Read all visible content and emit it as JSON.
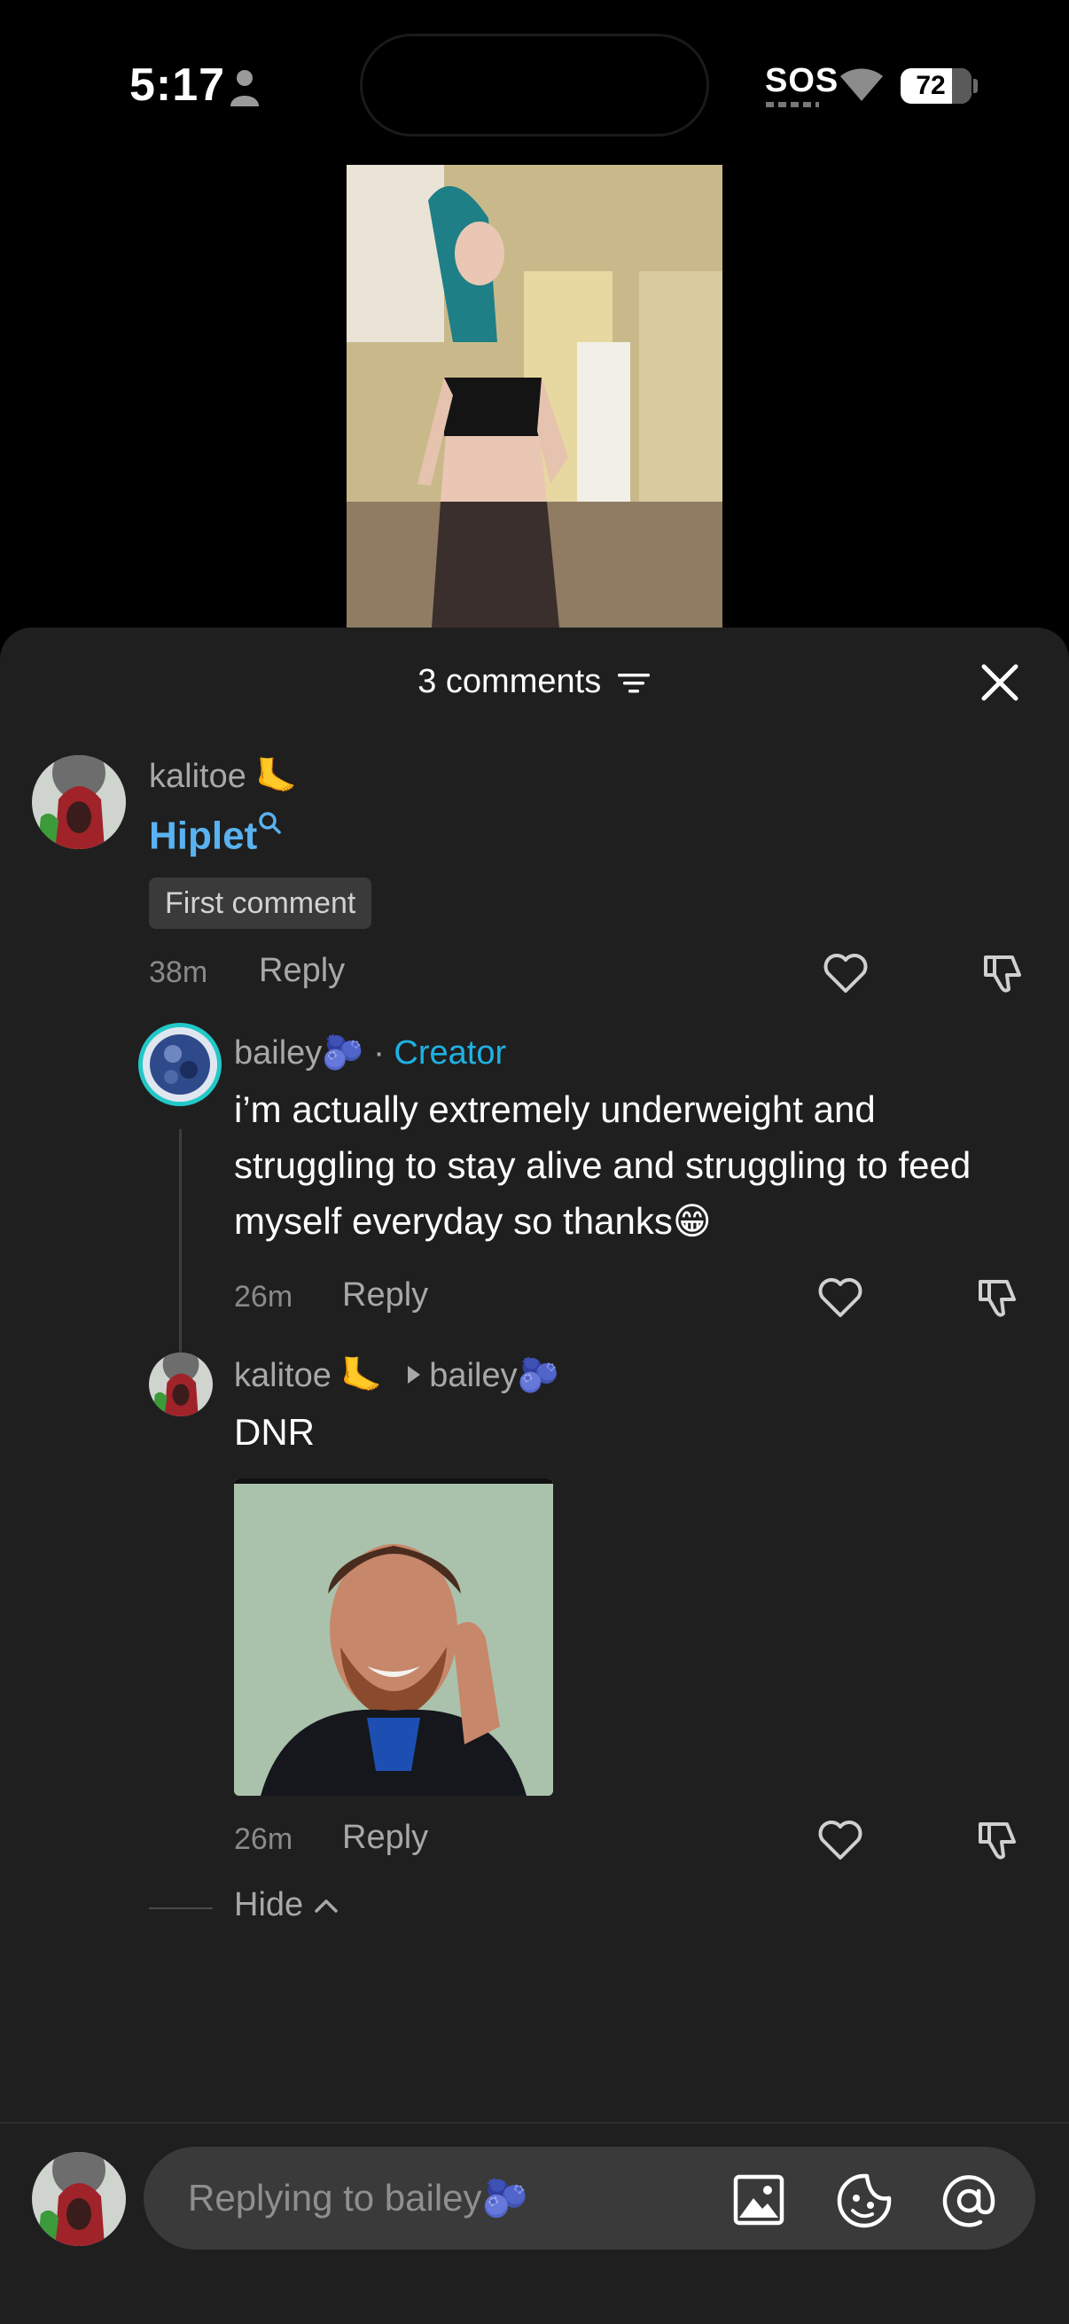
{
  "status_bar": {
    "time": "5:17",
    "carrier": "SOS",
    "battery": "72",
    "battery_fraction": 0.72,
    "icons": [
      "person-icon",
      "wifi-icon",
      "battery-icon"
    ]
  },
  "video": {
    "description_icon": "video-thumbnail"
  },
  "header": {
    "count_label": "3 comments",
    "icons": [
      "filter-icon",
      "close-icon"
    ]
  },
  "comments": [
    {
      "username": "kalitoe",
      "emoji": "🦶",
      "search_term": "Hiplet",
      "badge": "First comment",
      "time": "38m",
      "reply_label": "Reply"
    },
    {
      "username": "bailey",
      "emoji": "🫐",
      "separator": "·",
      "role": "Creator",
      "text": "i’m actually extremely underweight and struggling to stay alive and struggling to feed myself everyday so thanks😁",
      "time": "26m",
      "reply_label": "Reply"
    },
    {
      "username": "kalitoe",
      "emoji": "🦶",
      "reply_to": "bailey",
      "reply_to_emoji": "🫐",
      "text": "DNR",
      "time": "26m",
      "reply_label": "Reply"
    }
  ],
  "hide_label": "Hide",
  "input": {
    "placeholder": "Replying to bailey",
    "placeholder_emoji": "🫐",
    "icons": [
      "image-icon",
      "sticker-icon",
      "mention-icon"
    ]
  },
  "colors": {
    "sheet_bg": "#1f1f1f",
    "link_blue": "#5ab2f0",
    "creator_blue": "#1fb1e3",
    "muted": "#a8a8a8"
  }
}
